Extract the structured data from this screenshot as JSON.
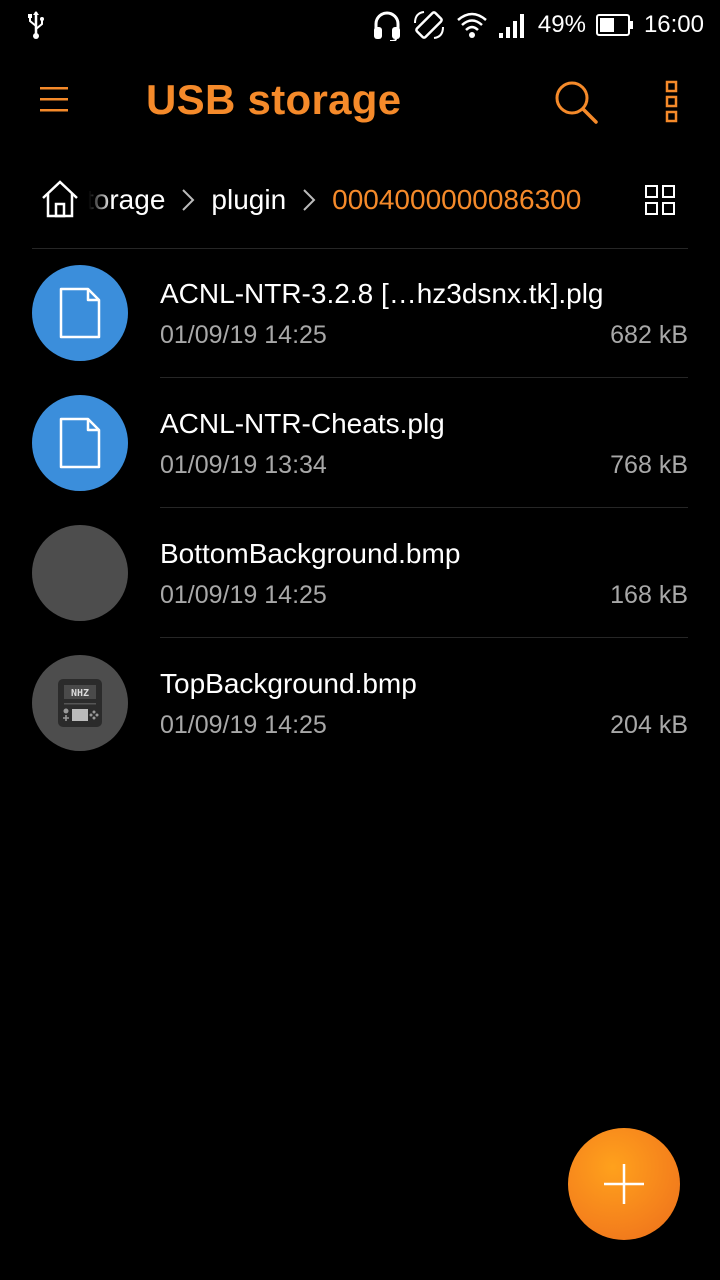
{
  "status_bar": {
    "battery_text": "49%",
    "time": "16:00",
    "icons": [
      "usb-icon",
      "headset-icon",
      "rotate-icon",
      "wifi-icon",
      "signal-icon",
      "battery-icon"
    ]
  },
  "app_bar": {
    "title": "USB storage",
    "menu_icon": "hamburger-menu-icon",
    "search_icon": "search-icon",
    "more_icon": "more-vert-icon",
    "accent_color": "#f58a2a"
  },
  "breadcrumb": {
    "items": [
      {
        "label": "storage"
      },
      {
        "label": "plugin"
      },
      {
        "label": "0004000000086300"
      }
    ]
  },
  "files": [
    {
      "name": "ACNL-NTR-3.2.8 […hz3dsnx.tk].plg",
      "date": "01/09/19 14:25",
      "size": "682 kB",
      "icon": "document-icon",
      "color": "#3b8edb"
    },
    {
      "name": "ACNL-NTR-Cheats.plg",
      "date": "01/09/19 13:34",
      "size": "768 kB",
      "icon": "document-icon",
      "color": "#3b8edb"
    },
    {
      "name": "BottomBackground.bmp",
      "date": "01/09/19 14:25",
      "size": "168 kB",
      "icon": "image-thumbnail",
      "color": "#4d4d4d"
    },
    {
      "name": "TopBackground.bmp",
      "date": "01/09/19 14:25",
      "size": "204 kB",
      "icon": "console-thumbnail-icon",
      "color": "#4d4d4d"
    }
  ],
  "fab": {
    "icon": "add-icon"
  }
}
